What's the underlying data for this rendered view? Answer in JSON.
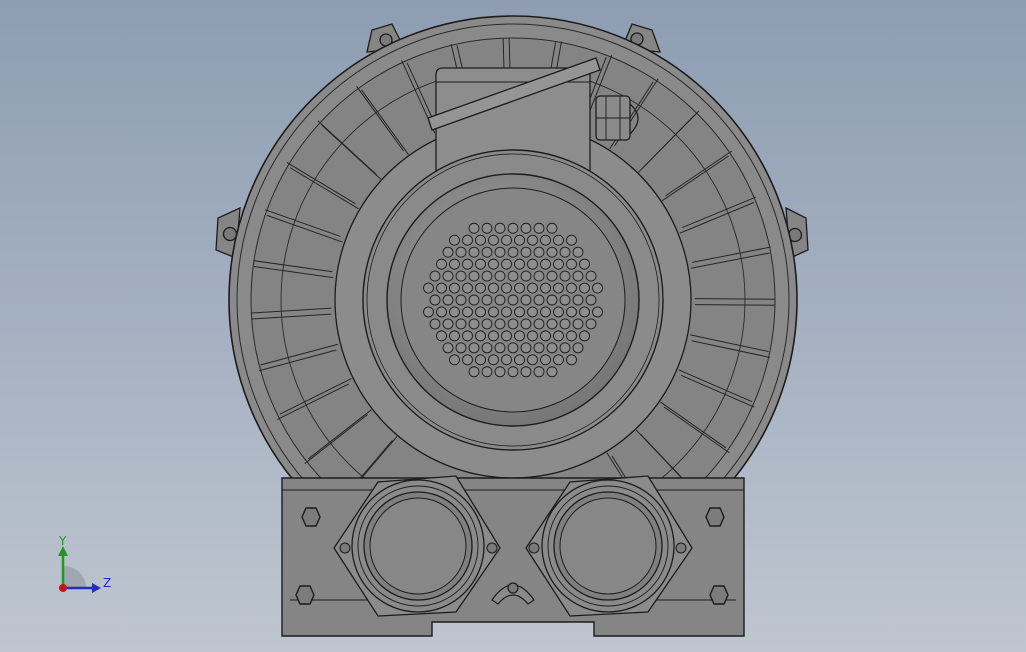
{
  "view": {
    "colors": {
      "bg_top": "#8e9db2",
      "bg_bottom": "#bfc6d0",
      "metal": "#8a8a8a",
      "metal_dark": "#6e6e6e",
      "edge": "#1c1c1c"
    }
  },
  "triad": {
    "y_label": "Y",
    "z_label": "Z",
    "y_color": "#1f9a1f",
    "z_color": "#1f2fbf",
    "origin_color": "#c01818"
  }
}
